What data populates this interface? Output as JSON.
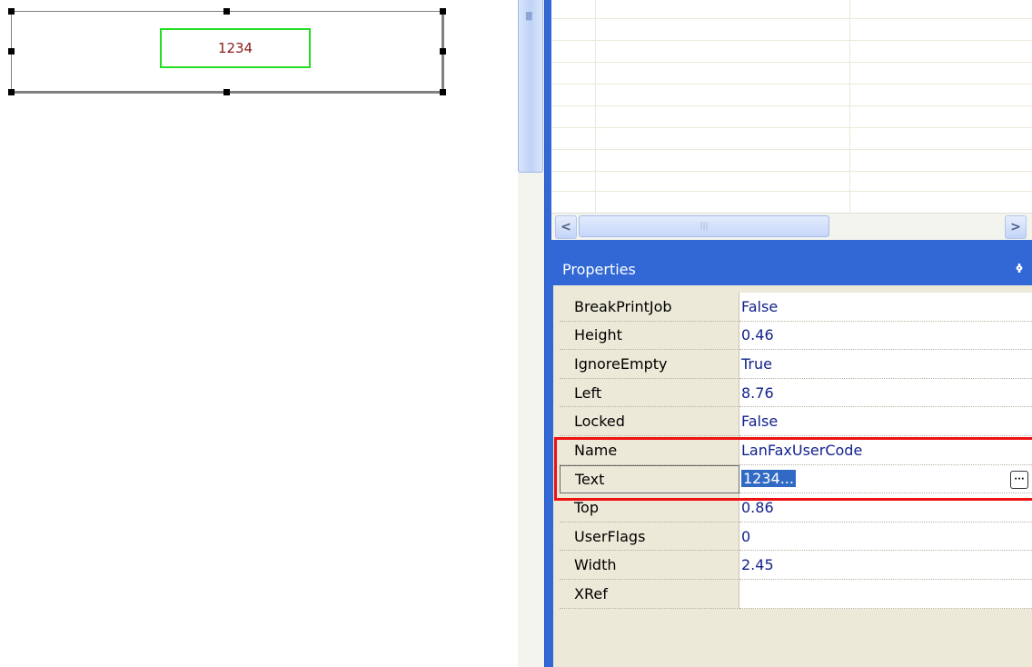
{
  "designer": {
    "field_text": "1234"
  },
  "grid_scroll": {
    "left_arrow": "<",
    "right_arrow": ">"
  },
  "properties": {
    "title": "Properties",
    "pin_icon": "pin-icon",
    "rows": [
      {
        "name": "BreakPrintJob",
        "value": "False"
      },
      {
        "name": "Height",
        "value": "0.46"
      },
      {
        "name": "IgnoreEmpty",
        "value": "True"
      },
      {
        "name": "Left",
        "value": "8.76"
      },
      {
        "name": "Locked",
        "value": "False"
      },
      {
        "name": "Name",
        "value": "LanFaxUserCode"
      },
      {
        "name": "Text",
        "value": "1234..."
      },
      {
        "name": "Top",
        "value": "0.86"
      },
      {
        "name": "UserFlags",
        "value": "0"
      },
      {
        "name": "Width",
        "value": "2.45"
      },
      {
        "name": "XRef",
        "value": ""
      }
    ],
    "selected_row": "Text"
  },
  "colors": {
    "title_bar": "#3168d5",
    "highlight": "#ee1111",
    "field_border": "#22dd22"
  }
}
